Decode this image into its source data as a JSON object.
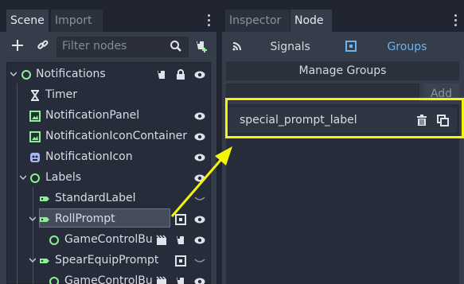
{
  "scene_dock": {
    "tabs": [
      {
        "label": "Scene",
        "active": true
      },
      {
        "label": "Import",
        "active": false
      }
    ],
    "filter_placeholder": "Filter nodes",
    "icons": {
      "add": "plus-icon",
      "link": "link-icon",
      "search": "search-icon",
      "script": "script-add-icon"
    },
    "tree": [
      {
        "label": "Notifications",
        "icon": "control-node-icon",
        "depth": 0,
        "expanded": true
      },
      {
        "label": "Timer",
        "icon": "timer-icon",
        "depth": 1
      },
      {
        "label": "NotificationPanel",
        "icon": "texture-rect-icon",
        "depth": 1
      },
      {
        "label": "NotificationIconContainer",
        "icon": "texture-rect-icon",
        "depth": 1
      },
      {
        "label": "NotificationIcon",
        "icon": "sprite-icon",
        "depth": 1
      },
      {
        "label": "Labels",
        "icon": "control-node-icon",
        "depth": 1,
        "expanded": true
      },
      {
        "label": "StandardLabel",
        "icon": "label-icon",
        "depth": 2
      },
      {
        "label": "RollPrompt",
        "icon": "label-icon",
        "depth": 2,
        "expanded": true,
        "selected": true
      },
      {
        "label": "GameControlBu",
        "icon": "control-node-icon",
        "depth": 3
      },
      {
        "label": "SpearEquipPrompt",
        "icon": "label-icon",
        "depth": 2,
        "expanded": true
      },
      {
        "label": "GameControlBu",
        "icon": "control-node-icon",
        "depth": 3
      }
    ]
  },
  "node_dock": {
    "tabs": [
      {
        "label": "Inspector",
        "active": false
      },
      {
        "label": "Node",
        "active": true
      }
    ],
    "signals_label": "Signals",
    "groups_label": "Groups",
    "manage_groups_label": "Manage Groups",
    "add_label": "Add",
    "groups": [
      {
        "name": "special_prompt_label"
      }
    ]
  },
  "colors": {
    "highlight": "#f5f50a",
    "accent": "#6ab4f0",
    "node_green": "#8eef97",
    "sprite_blue": "#a5b7f3"
  }
}
